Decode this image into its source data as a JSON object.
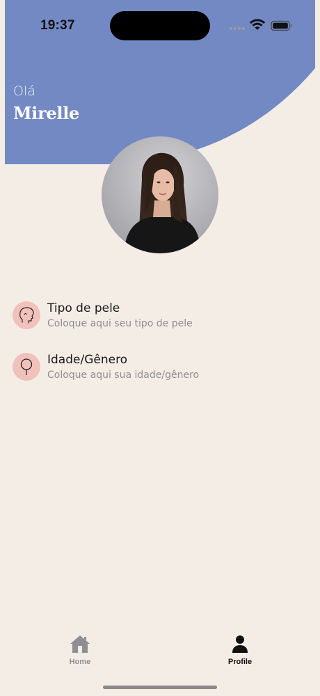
{
  "status_bar": {
    "time": "19:37"
  },
  "header": {
    "greeting": "Olá",
    "user_name": "Mirelle"
  },
  "profile_options": [
    {
      "title": "Tipo de pele",
      "subtitle": "Coloque aqui seu tipo de pele",
      "icon": "face-profile-icon"
    },
    {
      "title": "Idade/Gênero",
      "subtitle": "Coloque aqui sua idade/gênero",
      "icon": "gender-symbol-icon"
    }
  ],
  "tab_bar": {
    "items": [
      {
        "label": "Home",
        "icon": "house-icon",
        "active": false
      },
      {
        "label": "Profile",
        "icon": "person-icon",
        "active": true
      }
    ]
  },
  "colors": {
    "header_blue": "#7389c4",
    "background": "#f4ede6",
    "icon_circle": "#f1c1bb",
    "active_tab": "#111111",
    "inactive_tab": "#8e8e93"
  }
}
